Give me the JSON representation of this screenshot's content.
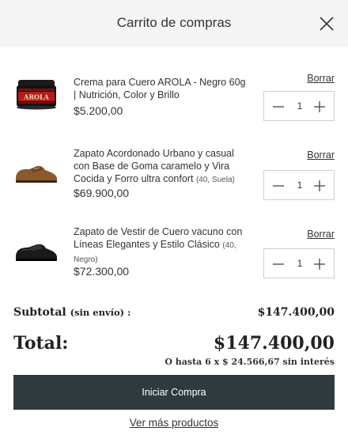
{
  "header": {
    "title": "Carrito de compras",
    "close_icon": "close-icon"
  },
  "items": [
    {
      "name": "Crema para Cuero AROLA - Negro 60g | Nutrición, Color y Brillo",
      "variant": "",
      "price": "$5.200,00",
      "remove_label": "Borrar",
      "quantity": "1",
      "thumb_brand": "AROLA"
    },
    {
      "name": "Zapato Acordonado Urbano y casual con Base de Goma caramelo y Vira Cocida y Forro ultra confort",
      "variant": "(40, Suela)",
      "price": "$69.900,00",
      "remove_label": "Borrar",
      "quantity": "1"
    },
    {
      "name": "Zapato de Vestir de Cuero vacuno con Líneas Elegantes y Estilo Clásico",
      "variant": "(40, Negro)",
      "price": "$72.300,00",
      "remove_label": "Borrar",
      "quantity": "1"
    }
  ],
  "summary": {
    "subtotal_label": "Subtotal",
    "subtotal_note": "(sin envío) :",
    "subtotal_value": "$147.400,00",
    "total_label": "Total:",
    "total_value": "$147.400,00",
    "installments": "O hasta 6 x $ 24.566,67 sin interés"
  },
  "actions": {
    "checkout_label": "Iniciar Compra",
    "more_products_label": "Ver más productos"
  },
  "colors": {
    "header_bg": "#f5f5f5",
    "button_bg": "#2f3a3f",
    "text": "#333333"
  }
}
